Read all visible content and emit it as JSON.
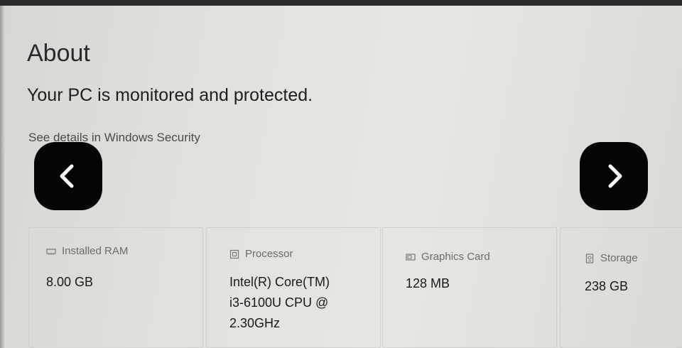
{
  "page": {
    "title": "About",
    "protection_status": "Your PC is monitored and protected.",
    "security_link": "See details in Windows Security"
  },
  "nav": {
    "prev_icon": "chevron-left-icon",
    "next_icon": "chevron-right-icon"
  },
  "specs": [
    {
      "icon": "ram-icon",
      "label": "Installed RAM",
      "value": "8.00 GB"
    },
    {
      "icon": "processor-icon",
      "label": "Processor",
      "value": "Intel(R) Core(TM)\ni3-6100U CPU @\n2.30GHz"
    },
    {
      "icon": "graphics-card-icon",
      "label": "Graphics Card",
      "value": "128 MB"
    },
    {
      "icon": "storage-icon",
      "label": "Storage",
      "value": "238 GB"
    }
  ]
}
